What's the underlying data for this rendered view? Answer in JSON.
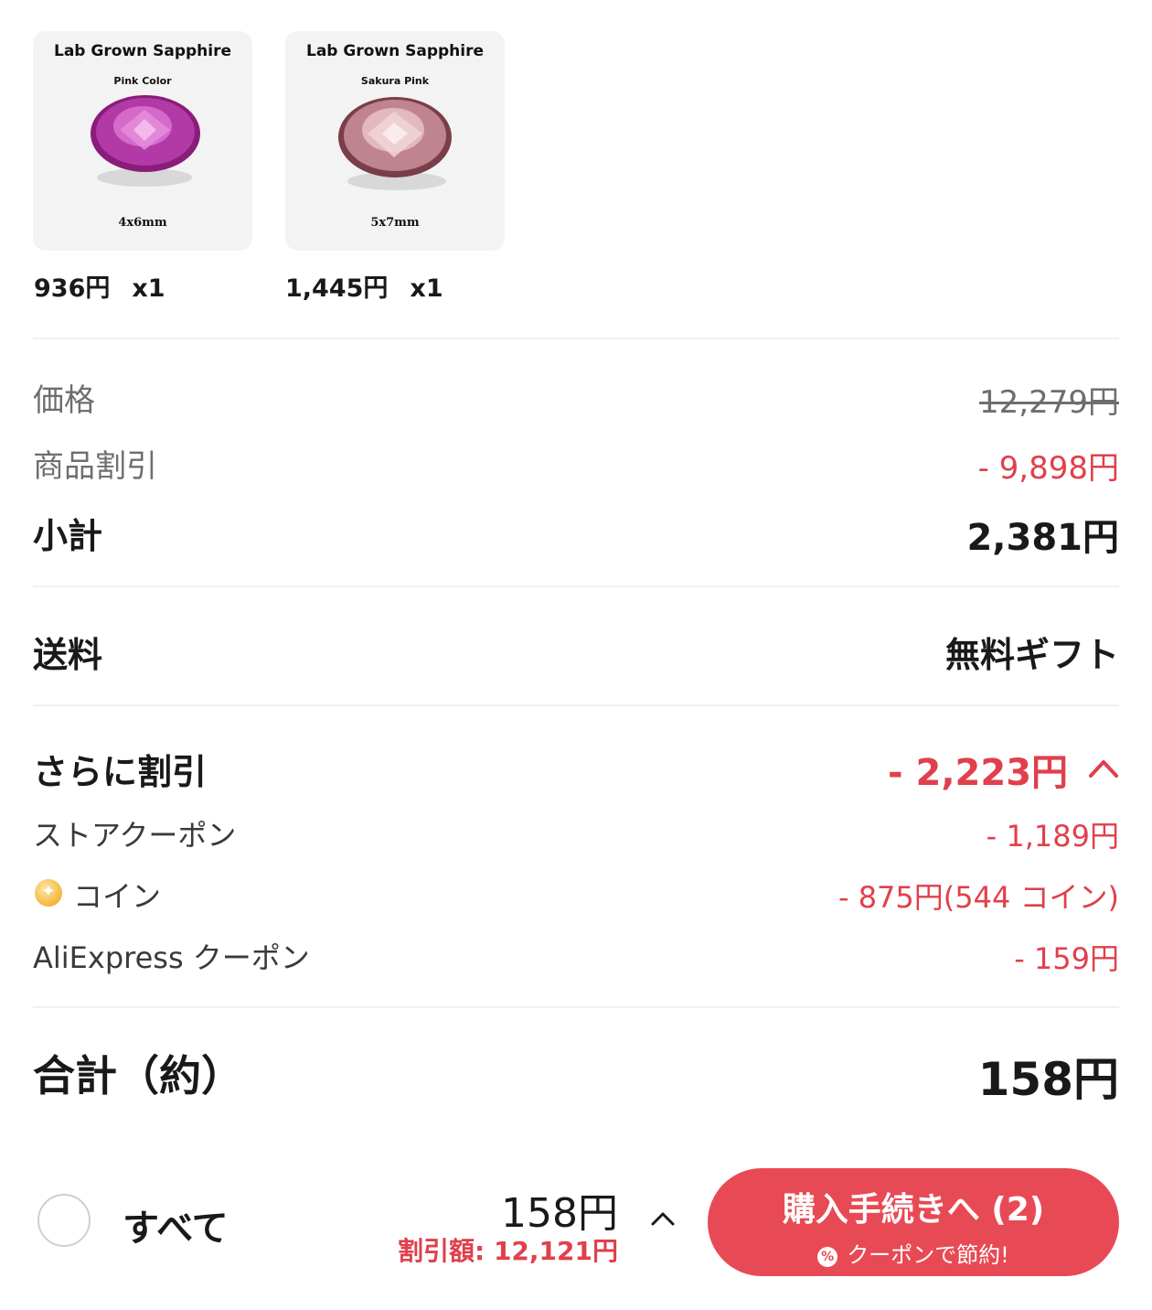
{
  "products": [
    {
      "image_title": "Lab Grown Sapphire",
      "image_color": "Pink Color",
      "image_size": "4x6mm",
      "price": "936円",
      "quantity": "x1"
    },
    {
      "image_title": "Lab Grown Sapphire",
      "image_color": "Sakura Pink",
      "image_size": "5x7mm",
      "price": "1,445円",
      "quantity": "x1"
    }
  ],
  "summary": {
    "price_label": "価格",
    "price_value": "12,279円",
    "product_discount_label": "商品割引",
    "product_discount_value": "- 9,898円",
    "subtotal_label": "小計",
    "subtotal_value": "2,381円",
    "shipping_label": "送料",
    "shipping_value": "無料ギフト",
    "extra_discount_label": "さらに割引",
    "extra_discount_value": "- 2,223円",
    "store_coupon_label": "ストアクーポン",
    "store_coupon_value": "- 1,189円",
    "coin_label": "コイン",
    "coin_value": "- 875円(544 コイン)",
    "aliexpress_coupon_label": "AliExpress クーポン",
    "aliexpress_coupon_value": "- 159円",
    "total_label": "合計（約）",
    "total_value": "158円"
  },
  "footer": {
    "select_all_label": "すべて",
    "total_price": "158円",
    "discount_amount": "割引額: 12,121円",
    "checkout_label": "購入手続きへ (2)",
    "checkout_sub": "クーポンで節約!",
    "percent_icon_glyph": "%"
  },
  "colors": {
    "accent_red": "#e84a55",
    "discount_red": "#e0404b",
    "gray_text": "#6e6e6e"
  }
}
